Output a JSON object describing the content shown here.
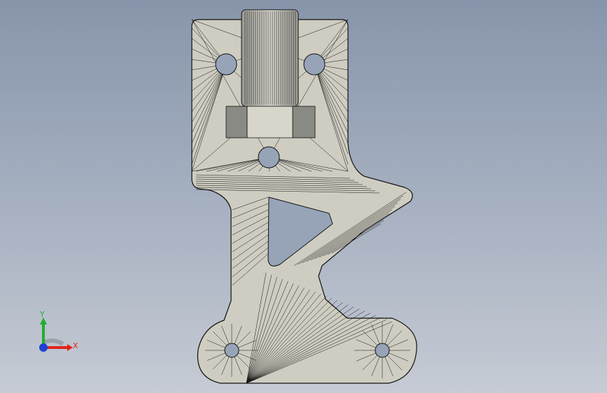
{
  "viewport": {
    "background_top": "#8795ab",
    "background_bottom": "#c6cbd4"
  },
  "model": {
    "face_color": "#cfcdc1",
    "dark_face_color": "#8a8a84",
    "edge_color": "#111111",
    "hole_color": "#97a4b8",
    "display_style": "shaded-with-edges (tessellated mesh)"
  },
  "triad": {
    "x_label": "X",
    "y_label": "Y",
    "x_color": "#e0241b",
    "y_color": "#1fae2e",
    "z_color": "#1f3fd6"
  }
}
